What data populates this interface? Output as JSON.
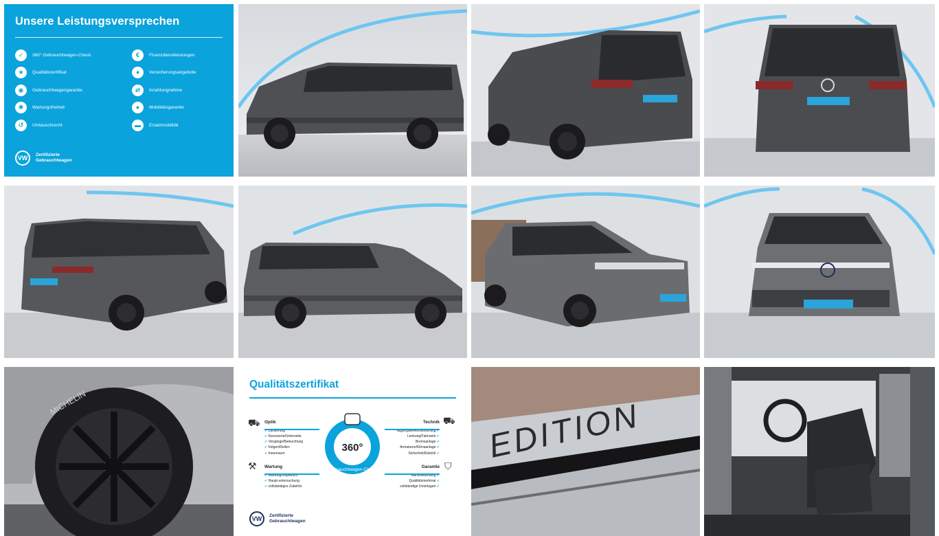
{
  "promise": {
    "title": "Unsere Leistungsversprechen",
    "items": [
      {
        "label": "360° Gebrauchtwagen-Check",
        "icon": "checklist-icon"
      },
      {
        "label": "Finanzdienstleistungen",
        "icon": "finance-icon"
      },
      {
        "label": "Qualitätszertifikat",
        "icon": "certificate-icon"
      },
      {
        "label": "Versicherungsangebote",
        "icon": "insurance-icon"
      },
      {
        "label": "Gebrauchtwagengarantie",
        "icon": "warranty-icon"
      },
      {
        "label": "Inzahlungnahme",
        "icon": "trade-in-icon"
      },
      {
        "label": "Wartungsfreiheit",
        "icon": "maintenance-icon"
      },
      {
        "label": "Mobilitätsgarantie",
        "icon": "mobility-icon"
      },
      {
        "label": "Umtauschrecht",
        "icon": "exchange-icon"
      },
      {
        "label": "Ersatzmobilität",
        "icon": "replacement-car-icon"
      }
    ],
    "logo_line1": "Zertifizierte",
    "logo_line2": "Gebrauchtwagen"
  },
  "quality": {
    "title": "Qualitätszertifikat",
    "badge_value": "360°",
    "badge_label": "Gebrauchtwagen-Check",
    "optik": {
      "head": "Optik",
      "lines": [
        "Lackierung",
        "Karosserie/Unterseite",
        "Vorgänge/Beleuchtung",
        "Felgen/Reifen",
        "Innenraum"
      ]
    },
    "technik": {
      "head": "Technik",
      "lines": [
        "Aggregate/Antriebsstrang",
        "Lenkung/Fahrwerk",
        "Bremsanlage",
        "Armaturen/Klimaanlage",
        "Sicherheit/Elektrik"
      ]
    },
    "wartung": {
      "head": "Wartung",
      "lines": [
        "Wartung/Inspektion",
        "Haupt-untersuchung",
        "vollständiges Zubehör"
      ]
    },
    "garantie": {
      "head": "Garantie",
      "lines": [
        "Garantieumfang",
        "Qualitätsmerkmal",
        "vollständige Unterlagen"
      ]
    },
    "logo_line1": "Zertifizierte",
    "logo_line2": "Gebrauchtwagen"
  },
  "photos": [
    {
      "name": "photo-side-left-van"
    },
    {
      "name": "photo-rear-three-quarter-van"
    },
    {
      "name": "photo-rear-van"
    },
    {
      "name": "photo-rear-three-quarter-right-van"
    },
    {
      "name": "photo-side-right-van"
    },
    {
      "name": "photo-front-three-quarter-van"
    },
    {
      "name": "photo-front-van"
    },
    {
      "name": "photo-wheel-closeup"
    },
    {
      "name": "photo-edition-decal"
    },
    {
      "name": "photo-interior-seats"
    }
  ],
  "wheel_brand": "MICHELIN",
  "decal_text": "EDITION",
  "colors": {
    "accent": "#0aa3dc",
    "van_body": "#5a5b5f",
    "floor": "#c9cbcf"
  }
}
